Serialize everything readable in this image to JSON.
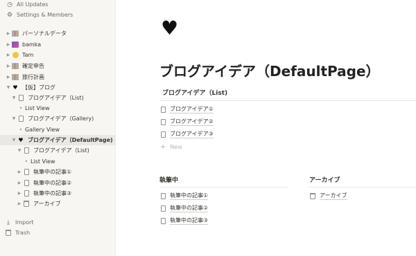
{
  "sidebar": {
    "top": [
      {
        "label": "All Updates",
        "icon": "clock-icon"
      },
      {
        "label": "Settings & Members",
        "icon": "gear-icon"
      }
    ],
    "pages": [
      {
        "label": "パーソナルデータ",
        "icon": "book-icon"
      },
      {
        "label": "bamka",
        "icon": "picture-icon"
      },
      {
        "label": "Tam",
        "icon": "sun-icon"
      },
      {
        "label": "確定申告",
        "icon": "book-icon"
      },
      {
        "label": "旅行計画",
        "icon": "book-icon"
      },
      {
        "label": "【仮】ブログ",
        "icon": "heart-icon"
      },
      {
        "label": "ブログアイデア（List)",
        "icon": "document-icon"
      },
      {
        "label": "List View",
        "icon": "bullet"
      },
      {
        "label": "ブログアイデア（Gallery)",
        "icon": "document-icon"
      },
      {
        "label": "Gallery View",
        "icon": "bullet"
      },
      {
        "label": "ブログアイデア（DefaultPage)",
        "icon": "heart-icon"
      },
      {
        "label": "ブログアイデア（List)",
        "icon": "document-icon"
      },
      {
        "label": "List View",
        "icon": "bullet"
      },
      {
        "label": "執筆中の記事①",
        "icon": "document-icon"
      },
      {
        "label": "執筆中の記事②",
        "icon": "document-icon"
      },
      {
        "label": "執筆中の記事③",
        "icon": "document-icon"
      },
      {
        "label": "アーカイブ",
        "icon": "trash-icon"
      }
    ],
    "bottom": [
      {
        "label": "Import",
        "icon": "import-icon"
      },
      {
        "label": "Trash",
        "icon": "trash-icon"
      }
    ]
  },
  "main": {
    "page_icon": "heart-icon",
    "title": "ブログアイデア（DefaultPage）",
    "list_section": {
      "title": "ブログアイデア（List)",
      "items": [
        "ブログアイデア①",
        "ブログアイデア②",
        "ブログアイデア③"
      ],
      "new_label": "New"
    },
    "columns": [
      {
        "title": "執筆中",
        "items": [
          "執筆中の記事①",
          "執筆中の記事②",
          "執筆中の記事③"
        ]
      },
      {
        "title": "アーカイブ",
        "items": [
          "アーカイブ"
        ]
      }
    ]
  }
}
